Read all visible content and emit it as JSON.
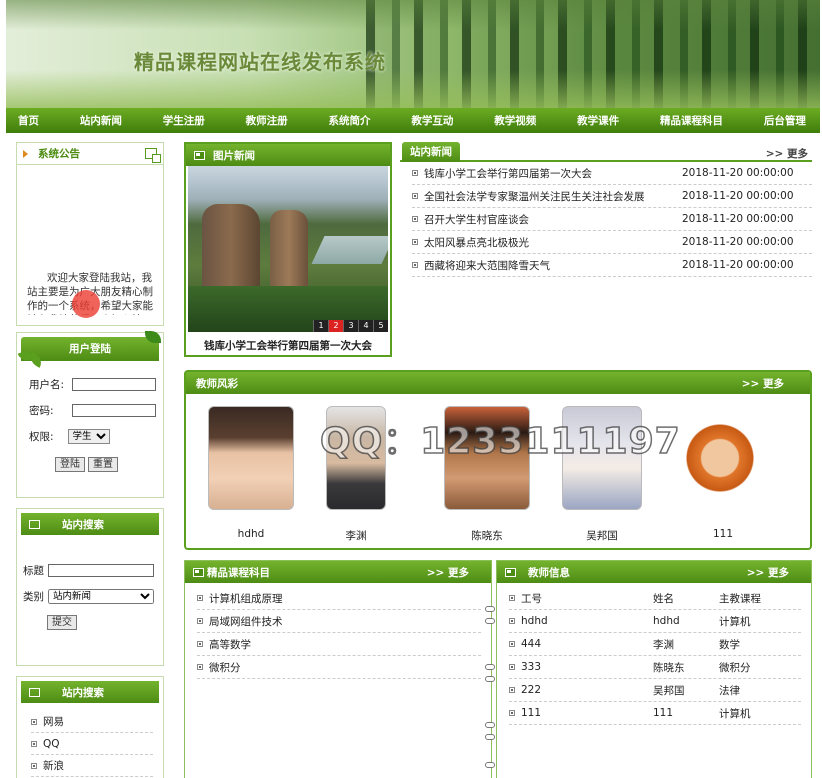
{
  "banner": {
    "title": "精品课程网站在线发布系统"
  },
  "nav": [
    "首页",
    "站内新闻",
    "学生注册",
    "教师注册",
    "系统简介",
    "教学互动",
    "教学视频",
    "教学课件",
    "精品课程科目",
    "后台管理"
  ],
  "notice": {
    "title": "系统公告",
    "text": "欢迎大家登陆我站，我站主要是为广大朋友精心制作的一个系统，希望大家能够在我站获得一个好心情"
  },
  "login": {
    "title": "用户登陆",
    "username_label": "用户名:",
    "password_label": "密码:",
    "role_label": "权限:",
    "role_value": "学生",
    "login_btn": "登陆",
    "reset_btn": "重置"
  },
  "search": {
    "title": "站内搜索",
    "title_label": "标题",
    "category_label": "类别",
    "category_value": "站内新闻",
    "submit_btn": "提交"
  },
  "links": {
    "title": "站内搜索",
    "items": [
      "网易",
      "QQ",
      "新浪"
    ]
  },
  "picnews": {
    "title": "图片新闻",
    "caption": "钱库小学工会举行第四届第一次大会",
    "pages": [
      "1",
      "2",
      "3",
      "4",
      "5"
    ],
    "active_page": "2"
  },
  "news": {
    "tab": "站内新闻",
    "more": ">> 更多",
    "items": [
      {
        "title": "钱库小学工会举行第四届第一次大会",
        "date": "2018-11-20 00:00:00"
      },
      {
        "title": "全国社会法学专家聚温州关注民生关注社会发展",
        "date": "2018-11-20 00:00:00"
      },
      {
        "title": "召开大学生村官座谈会",
        "date": "2018-11-20 00:00:00"
      },
      {
        "title": "太阳风暴点亮北极极光",
        "date": "2018-11-20 00:00:00"
      },
      {
        "title": "西藏将迎来大范围降雪天气",
        "date": "2018-11-20 00:00:00"
      }
    ]
  },
  "teachers": {
    "title": "教师风彩",
    "more": ">> 更多",
    "names": [
      "hdhd",
      "李渊",
      "陈晓东",
      "吴邦国",
      "111"
    ]
  },
  "watermark": "QQ：1233111197",
  "subjects": {
    "title": "精品课程科目",
    "more": ">> 更多",
    "items": [
      "计算机组成原理",
      "局域网组件技术",
      "高等数学",
      "微积分"
    ]
  },
  "tinfo": {
    "title": "教师信息",
    "more": ">> 更多",
    "header": [
      "工号",
      "姓名",
      "主教课程"
    ],
    "rows": [
      [
        "hdhd",
        "hdhd",
        "计算机"
      ],
      [
        "444",
        "李渊",
        "数学"
      ],
      [
        "333",
        "陈晓东",
        "微积分"
      ],
      [
        "222",
        "吴邦国",
        "法律"
      ],
      [
        "111",
        "111",
        "计算机"
      ]
    ]
  }
}
